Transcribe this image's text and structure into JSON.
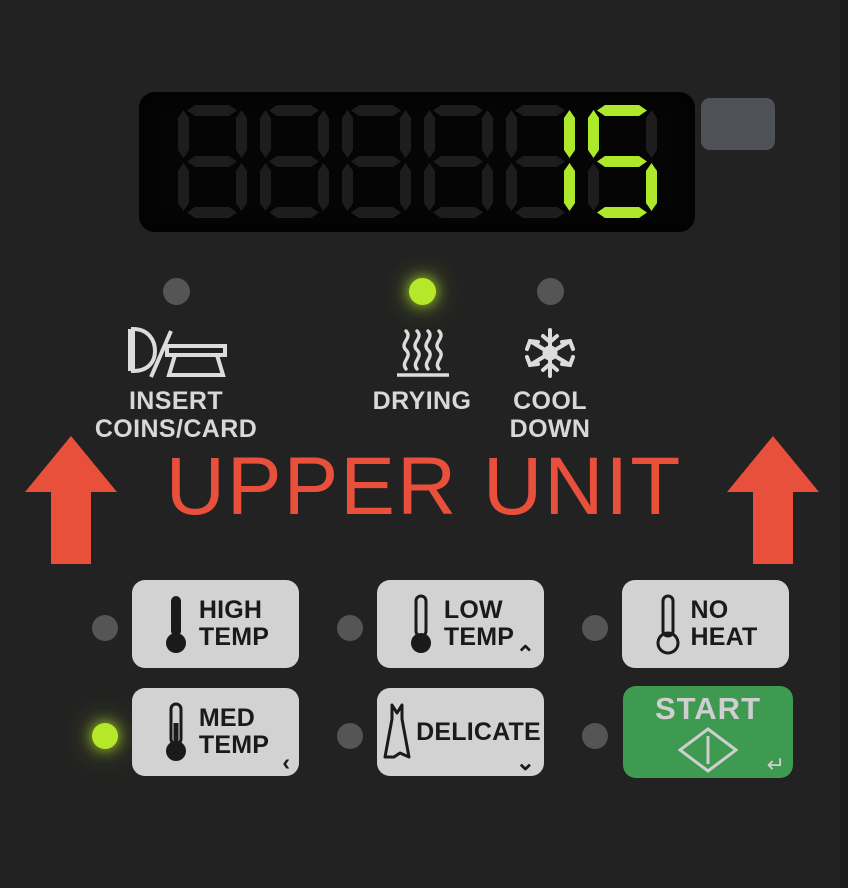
{
  "panel": {
    "background_color": "#222222",
    "unit_banner": {
      "title": "UPPER UNIT",
      "color": "#e8503c",
      "arrow_left_name": "up-arrow-left",
      "arrow_right_name": "up-arrow-right"
    }
  },
  "display": {
    "digit_count": 6,
    "value": "15",
    "lit_color": "#aee82a",
    "unlit_color": "#1d1d1d",
    "segments": [
      {
        "index": 0,
        "char": "",
        "lit": false
      },
      {
        "index": 1,
        "char": "",
        "lit": false
      },
      {
        "index": 2,
        "char": "",
        "lit": false
      },
      {
        "index": 3,
        "char": "",
        "lit": false
      },
      {
        "index": 4,
        "char": "1",
        "lit": true
      },
      {
        "index": 5,
        "char": "5",
        "lit": true
      }
    ]
  },
  "blank_button": {
    "label": "",
    "color": "#4e5158"
  },
  "status_indicators": [
    {
      "id": "insert",
      "caption": "INSERT\nCOINS/CARD",
      "icon": "coin-card-slot-icon",
      "lit": false,
      "led_color": "#555555"
    },
    {
      "id": "drying",
      "caption": "DRYING",
      "icon": "heat-waves-icon",
      "lit": true,
      "led_color": "#b6e82a"
    },
    {
      "id": "cool_down",
      "caption": "COOL\nDOWN",
      "icon": "snowflake-icon",
      "lit": false,
      "led_color": "#555555"
    }
  ],
  "cycle_buttons": [
    {
      "id": "high_temp",
      "label": "HIGH\nTEMP",
      "icon": "thermometer-full-icon",
      "selected": false,
      "corner_mark": ""
    },
    {
      "id": "low_temp",
      "label": "LOW\nTEMP",
      "icon": "thermometer-low-icon",
      "selected": false,
      "corner_mark": "⌃"
    },
    {
      "id": "no_heat",
      "label": "NO\nHEAT",
      "icon": "thermometer-empty-icon",
      "selected": false,
      "corner_mark": ""
    },
    {
      "id": "med_temp",
      "label": "MED\nTEMP",
      "icon": "thermometer-medium-icon",
      "selected": true,
      "corner_mark": "‹"
    },
    {
      "id": "delicate",
      "label": "DELICATE",
      "icon": "dress-icon",
      "selected": false,
      "corner_mark": "⌄"
    }
  ],
  "start_button": {
    "label": "START",
    "symbol": "power-diamond-icon",
    "enter_mark": "↵",
    "color": "#3f9a51",
    "selected": false
  }
}
